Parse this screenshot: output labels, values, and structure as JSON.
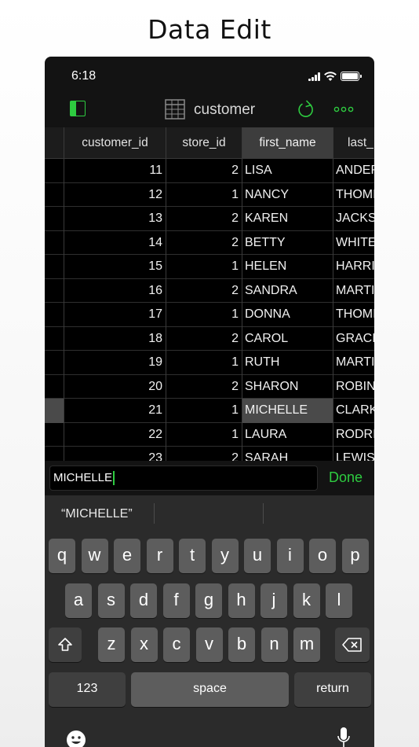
{
  "headline": "Data Edit",
  "status": {
    "time": "6:18"
  },
  "nav": {
    "title": "customer"
  },
  "grid": {
    "columns": [
      "customer_id",
      "store_id",
      "first_name",
      "last_"
    ],
    "rows": [
      [
        "11",
        "2",
        "LISA",
        "ANDER"
      ],
      [
        "12",
        "1",
        "NANCY",
        "THOMI"
      ],
      [
        "13",
        "2",
        "KAREN",
        "JACKS"
      ],
      [
        "14",
        "2",
        "BETTY",
        "WHITE"
      ],
      [
        "15",
        "1",
        "HELEN",
        "HARRI"
      ],
      [
        "16",
        "2",
        "SANDRA",
        "MARTI"
      ],
      [
        "17",
        "1",
        "DONNA",
        "THOMI"
      ],
      [
        "18",
        "2",
        "CAROL",
        "GRACI"
      ],
      [
        "19",
        "1",
        "RUTH",
        "MARTI"
      ],
      [
        "20",
        "2",
        "SHARON",
        "ROBIN"
      ],
      [
        "21",
        "1",
        "MICHELLE",
        "CLARK"
      ],
      [
        "22",
        "1",
        "LAURA",
        "RODRI"
      ],
      [
        "23",
        "2",
        "SARAH",
        "LEWIS"
      ]
    ]
  },
  "edit": {
    "value": "MICHELLE",
    "done_label": "Done"
  },
  "keyboard": {
    "suggestion": "“MICHELLE”",
    "row1": [
      "q",
      "w",
      "e",
      "r",
      "t",
      "y",
      "u",
      "i",
      "o",
      "p"
    ],
    "row2": [
      "a",
      "s",
      "d",
      "f",
      "g",
      "h",
      "j",
      "k",
      "l"
    ],
    "row3": [
      "z",
      "x",
      "c",
      "v",
      "b",
      "n",
      "m"
    ],
    "numbers_label": "123",
    "space_label": "space",
    "return_label": "return"
  },
  "colors": {
    "accent": "#2ecc40",
    "background": "#131313",
    "key": "#5d5d5d"
  }
}
